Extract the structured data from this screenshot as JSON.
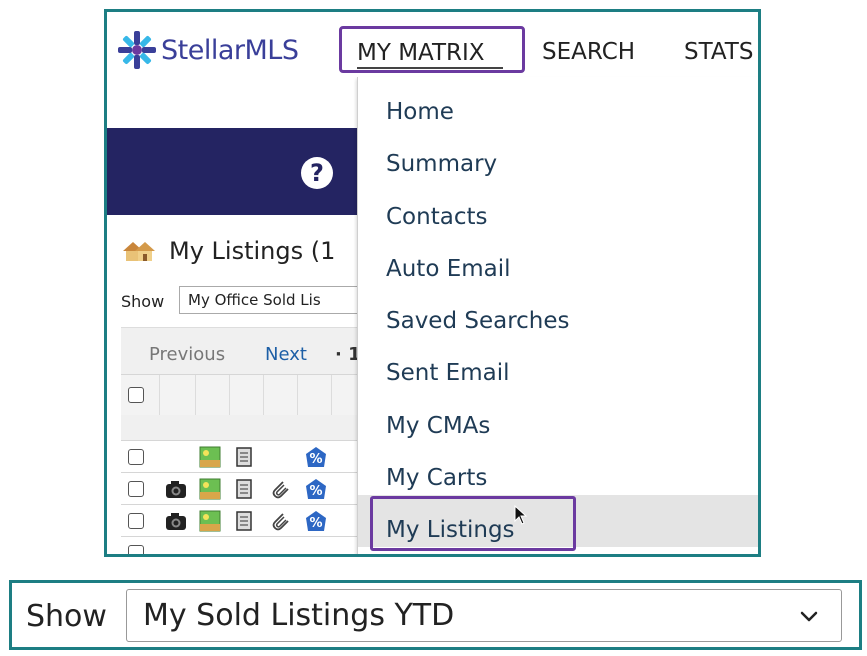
{
  "header": {
    "logo_text": "StellarMLS",
    "nav": {
      "my_matrix": "MY MATRIX",
      "search": "SEARCH",
      "stats": "STATS"
    }
  },
  "banner": {
    "help_glyph": "?"
  },
  "listings": {
    "title": "My Listings (1",
    "show_label": "Show",
    "show_value": "My Office Sold Lis",
    "pager": {
      "previous": "Previous",
      "next": "Next",
      "separator": "· 1"
    }
  },
  "menu": {
    "items": [
      "Home",
      "Summary",
      "Contacts",
      "Auto Email",
      "Saved Searches",
      "Sent Email",
      "My CMAs",
      "My Carts",
      "My Listings"
    ],
    "highlighted": "My Listings"
  },
  "bottom_select": {
    "label": "Show",
    "value": "My Sold Listings YTD"
  },
  "icons": {
    "logo": "star-burst-logo-icon",
    "help": "help-icon",
    "home": "house-icon",
    "camera": "camera-icon",
    "photo": "photo-icon",
    "printer": "printer-icon",
    "attachment": "paperclip-icon",
    "percent": "percent-badge-icon",
    "chevron": "chevron-down-icon",
    "cursor": "mouse-pointer-icon"
  },
  "colors": {
    "brand": "#3a3f99",
    "banner": "#242462",
    "highlight_border": "#6b3aa0",
    "frame": "#1d7e83",
    "link": "#1d5fa6"
  }
}
